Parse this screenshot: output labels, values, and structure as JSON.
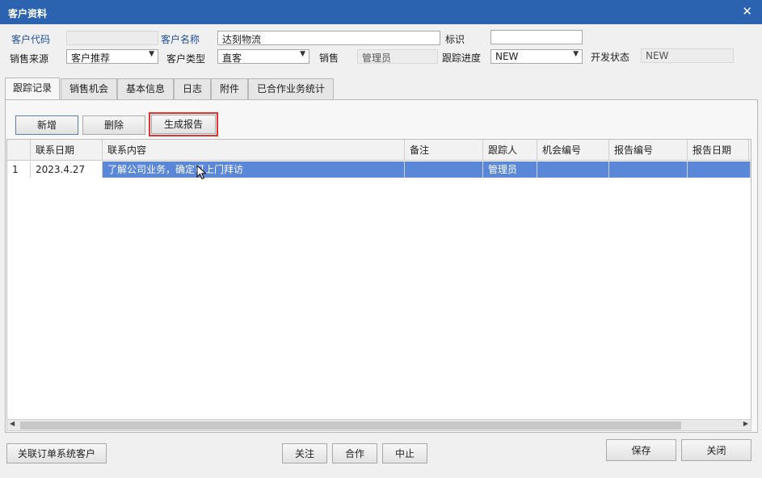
{
  "window": {
    "title": "客户资料"
  },
  "form": {
    "customer_code_label": "客户代码",
    "customer_code_value": "",
    "customer_name_label": "客户名称",
    "customer_name_value": "达刻物流",
    "mark_label": "标识",
    "mark_value": "",
    "source_label": "销售来源",
    "source_value": "客户推荐",
    "type_label": "客户类型",
    "type_value": "直客",
    "sales_label": "销售",
    "sales_value": "管理员",
    "progress_label": "跟踪进度",
    "progress_value": "NEW",
    "dev_status_label": "开发状态",
    "dev_status_value": "NEW"
  },
  "tabs": [
    {
      "label": "跟踪记录",
      "active": true
    },
    {
      "label": "销售机会"
    },
    {
      "label": "基本信息"
    },
    {
      "label": "日志"
    },
    {
      "label": "附件"
    },
    {
      "label": "已合作业务统计"
    }
  ],
  "toolbar": {
    "add": "新增",
    "delete": "删除",
    "report": "生成报告"
  },
  "grid": {
    "columns": [
      "",
      "联系日期",
      "联系内容",
      "备注",
      "跟踪人",
      "机会编号",
      "报告编号",
      "报告日期"
    ],
    "rows": [
      [
        "1",
        "2023.4.27",
        "了解公司业务，确定可上门拜访",
        "",
        "管理员",
        "",
        "",
        ""
      ]
    ]
  },
  "footer": {
    "link_customer": "关联订单系统客户",
    "follow": "关注",
    "cooperate": "合作",
    "stop": "中止",
    "save": "保存",
    "close": "关闭"
  },
  "icons": {
    "close": "close-icon",
    "dropdown": "chevron-down-icon",
    "cursor": "mouse-pointer-icon"
  },
  "colors": {
    "titlebar": "#2b63b1",
    "selection": "#5b87d9",
    "highlight": "#e0322f"
  }
}
